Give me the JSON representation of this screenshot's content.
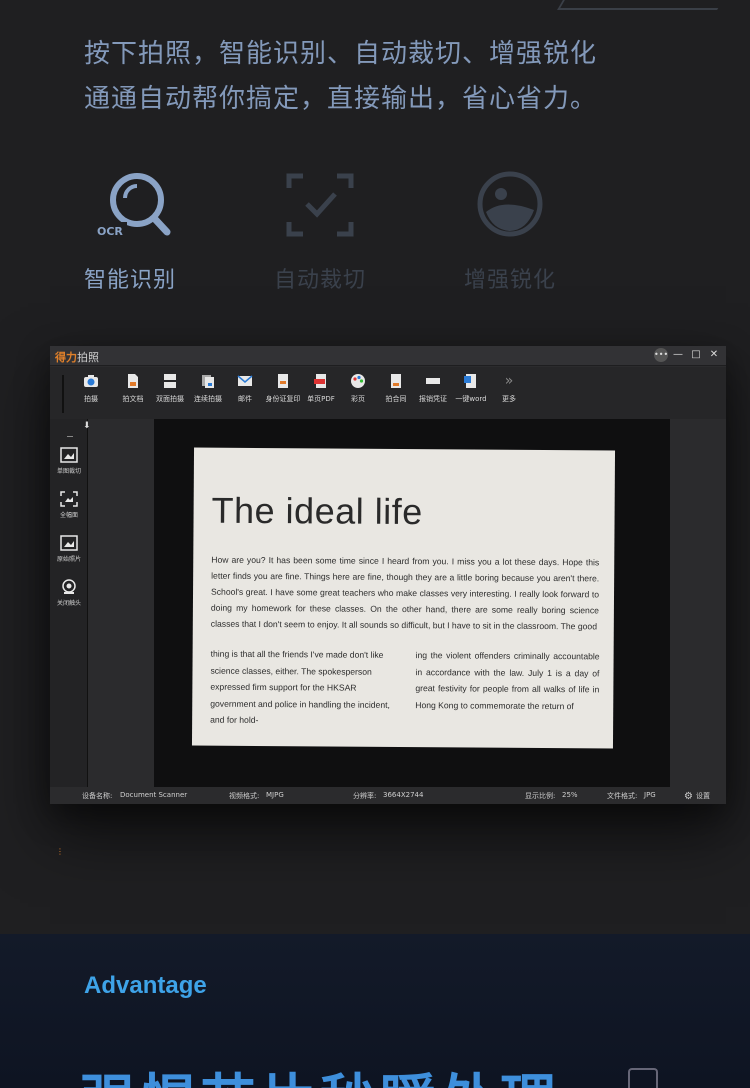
{
  "intro": {
    "line1": "按下拍照，智能识别、自动裁切、增强锐化",
    "line2": "通通自动帮你搞定，直接输出，省心省力。"
  },
  "features": [
    {
      "label": "智能识别",
      "icon": "ocr-search-icon",
      "icon_text": "OCR",
      "active": true
    },
    {
      "label": "自动裁切",
      "icon": "auto-crop-icon",
      "active": false
    },
    {
      "label": "增强锐化",
      "icon": "enhance-icon",
      "active": false
    }
  ],
  "app": {
    "brand": "得力",
    "title_rest": "拍照",
    "toolbar": [
      {
        "label": "拍摄",
        "icon": "camera-icon"
      },
      {
        "label": "拍文档",
        "icon": "document-icon"
      },
      {
        "label": "双面拍摄",
        "icon": "duplex-icon"
      },
      {
        "label": "连续拍摄",
        "icon": "continuous-icon"
      },
      {
        "label": "邮件",
        "icon": "mail-icon"
      },
      {
        "label": "身份证复印",
        "icon": "id-card-icon"
      },
      {
        "label": "单页PDF",
        "icon": "pdf-icon"
      },
      {
        "label": "彩页",
        "icon": "palette-icon"
      },
      {
        "label": "拍合同",
        "icon": "contract-icon"
      },
      {
        "label": "报销凭证",
        "icon": "receipt-icon"
      },
      {
        "label": "一键word",
        "icon": "word-icon"
      },
      {
        "label": "更多",
        "icon": "more-icon"
      }
    ],
    "side": [
      {
        "label": "单图裁切",
        "icon": "single-crop-icon"
      },
      {
        "label": "全幅面",
        "icon": "full-frame-icon"
      },
      {
        "label": "原始照片",
        "icon": "original-photo-icon"
      },
      {
        "label": "关闭触头",
        "icon": "close-camera-icon"
      }
    ],
    "document": {
      "heading": "The ideal life",
      "paragraph": "How are you?  It has been some time since I heard from you.  I miss you a lot these days.  Hope this letter finds you are fine.  Things here are fine, though they are a little boring because you aren't there. School's great.  I have some great teachers who make classes very interesting.  I really look forward to doing my homework for these classes.  On the other hand,  there are some really boring science classes that I don't seem to enjoy.  It all sounds so difficult,  but I have to sit in the classroom.  The good",
      "col1": "thing is that all the friends I've made don't like science classes,  either.  The spokesperson expressed firm support for the HKSAR government and police in handling the incident, and for hold-",
      "col2": "ing the violent offenders criminally accountable in accordance with the law.  July 1 is a day of great festivity for people from all walks of life in Hong Kong to commemorate the return of"
    },
    "status": {
      "device_label": "设备名称:",
      "device_value": "Document Scanner",
      "format_label": "视频格式:",
      "format_value": "MJPG",
      "resolution_label": "分辨率:",
      "resolution_value": "3664X2744",
      "zoom_label": "显示比例:",
      "zoom_value": "25%",
      "file_label": "文件格式:",
      "file_value": "JPG",
      "settings": "设置"
    }
  },
  "advantage": {
    "label": "Advantage",
    "title": "强悍芯片秒瞬处理"
  },
  "colors": {
    "brand_orange": "#e0802a",
    "accent_blue": "#3ea3e8"
  }
}
